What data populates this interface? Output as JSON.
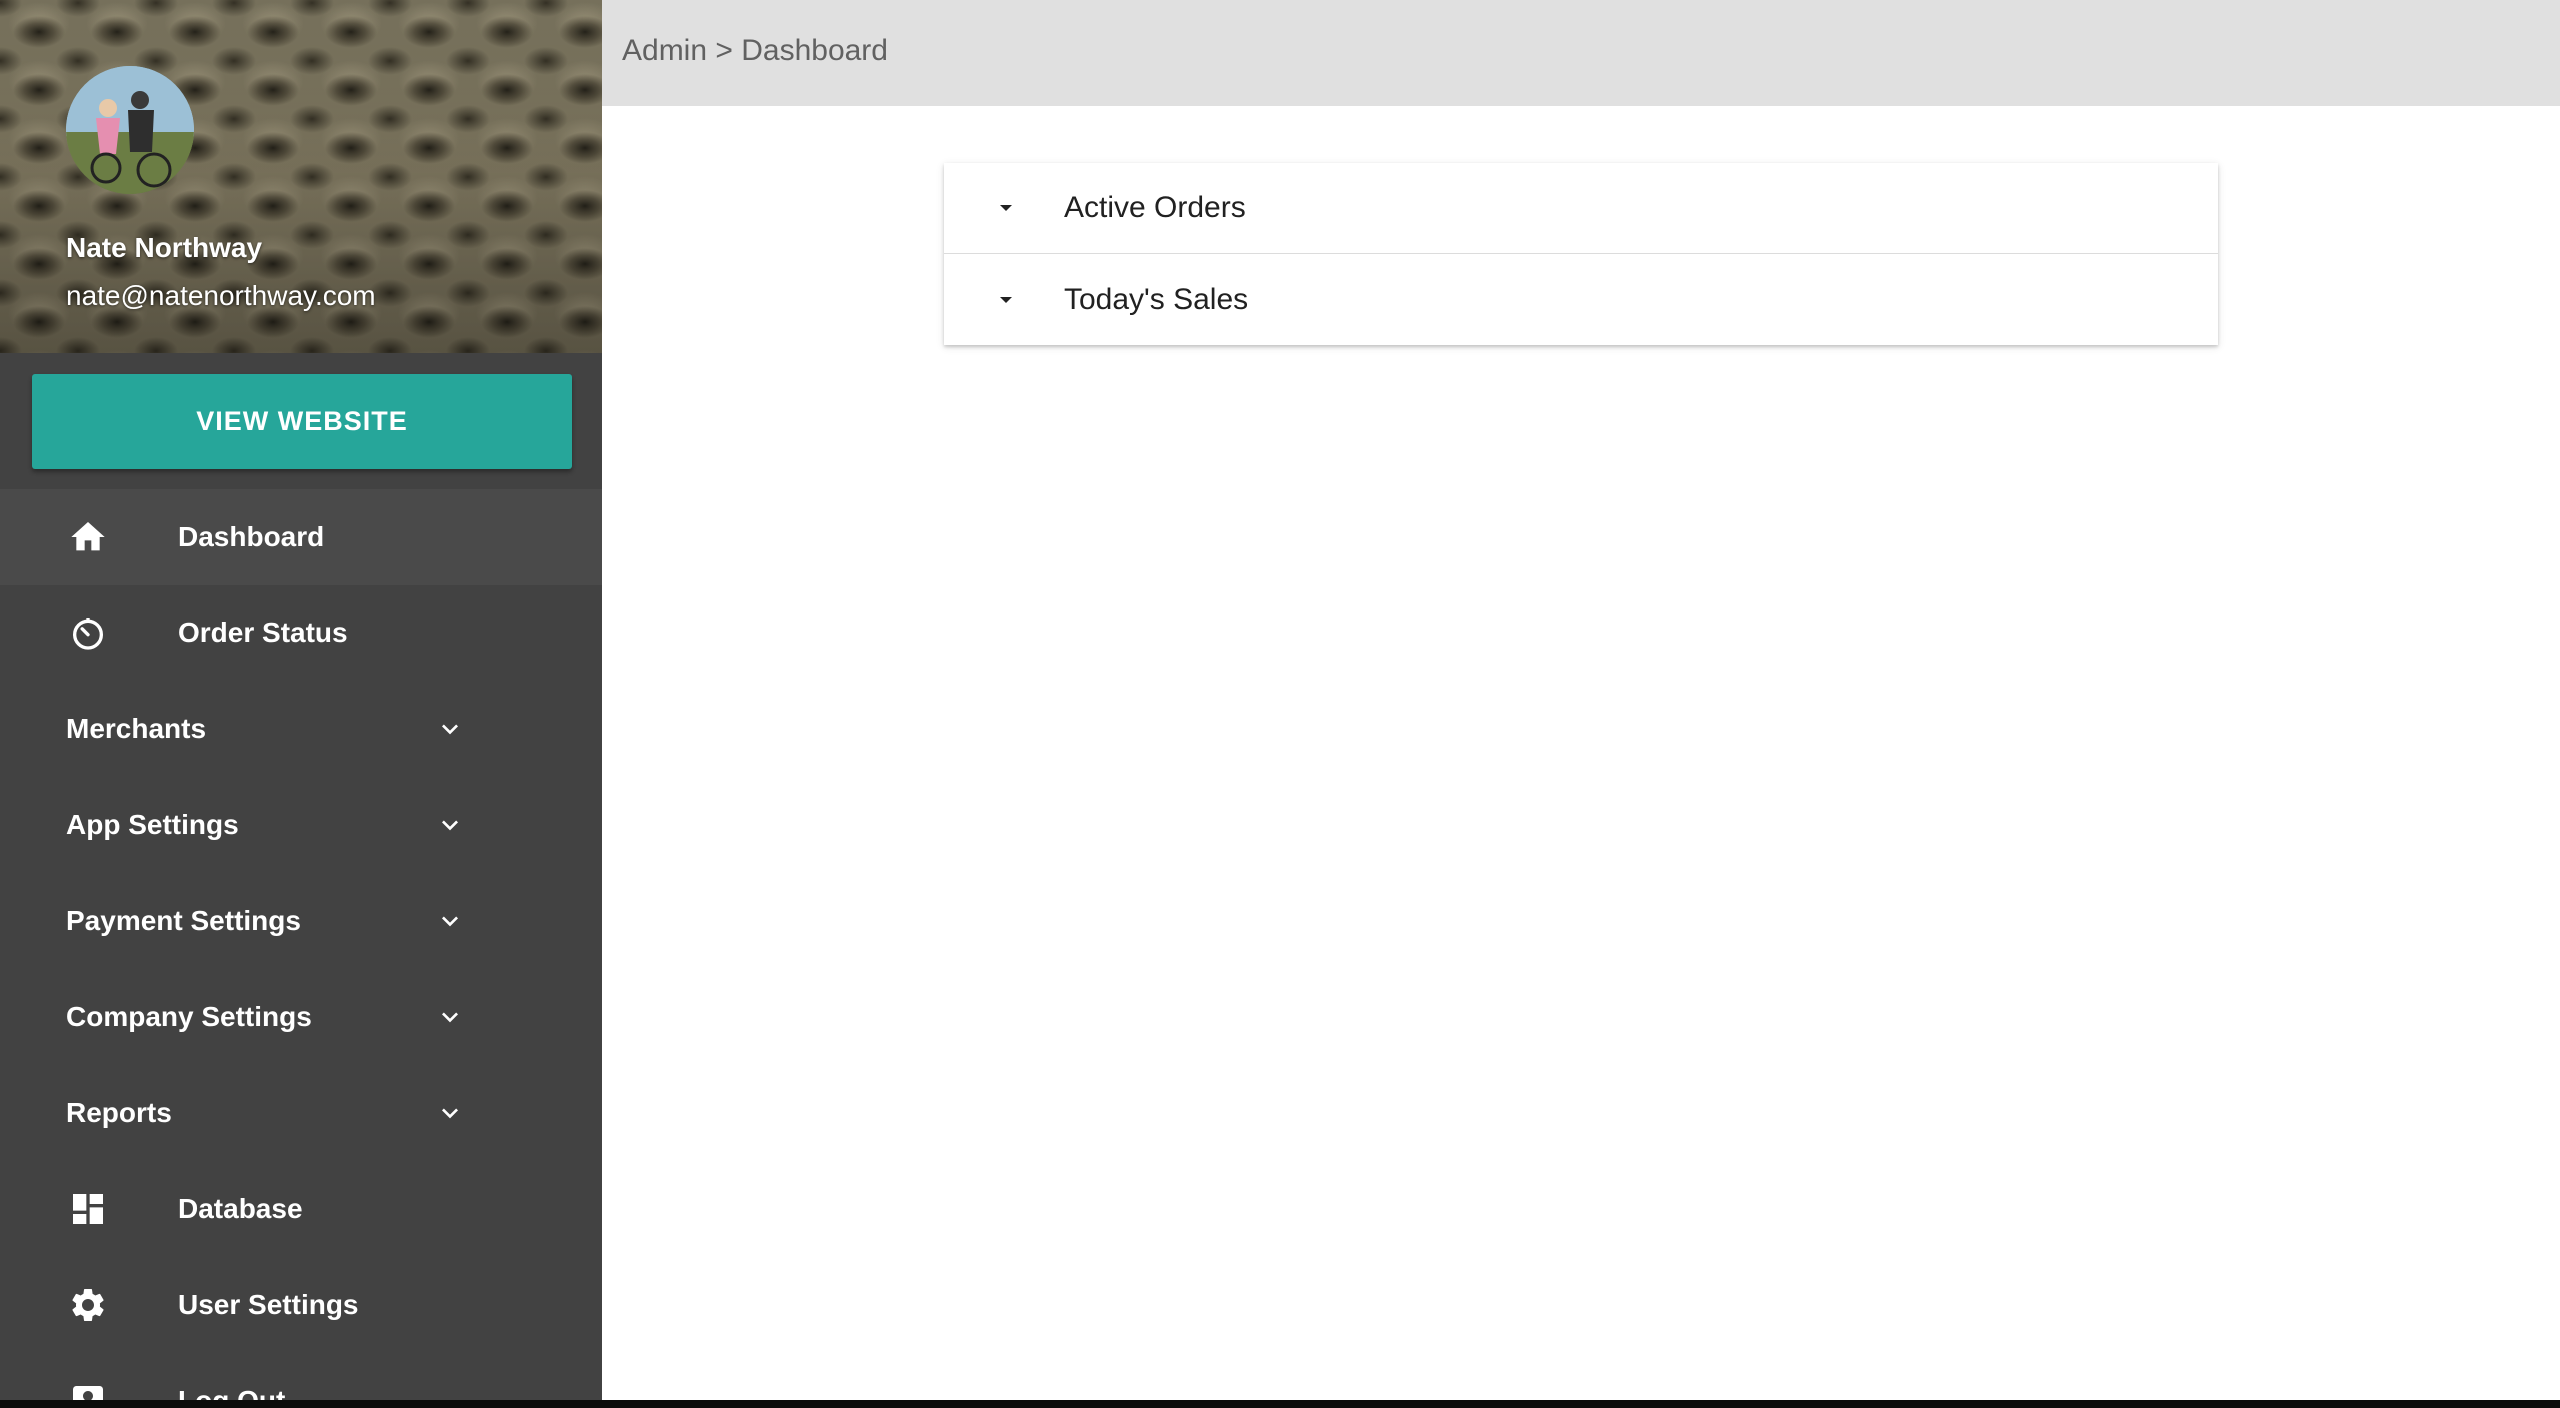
{
  "topbar": {
    "breadcrumb": "Admin > Dashboard"
  },
  "profile": {
    "name": "Nate Northway",
    "email": "nate@natenorthway.com"
  },
  "sidebar": {
    "view_website_label": "VIEW WEBSITE",
    "accent_color": "#26a69a",
    "items": [
      {
        "label": "Dashboard",
        "icon": "home-icon",
        "active": true
      },
      {
        "label": "Order Status",
        "icon": "timer-icon"
      },
      {
        "label": "Merchants",
        "icon": "chevron-down-icon"
      },
      {
        "label": "App Settings",
        "icon": "chevron-down-icon"
      },
      {
        "label": "Payment Settings",
        "icon": "chevron-down-icon"
      },
      {
        "label": "Company Settings",
        "icon": "chevron-down-icon"
      },
      {
        "label": "Reports",
        "icon": "chevron-down-icon"
      },
      {
        "label": "Database",
        "icon": "dashboard-grid-icon"
      },
      {
        "label": "User Settings",
        "icon": "gear-icon"
      },
      {
        "label": "Log Out",
        "icon": "account-box-icon"
      }
    ]
  },
  "main": {
    "panels": [
      {
        "title": "Active Orders",
        "icon": "caret-down-icon"
      },
      {
        "title": "Today's Sales",
        "icon": "caret-down-icon"
      }
    ]
  }
}
